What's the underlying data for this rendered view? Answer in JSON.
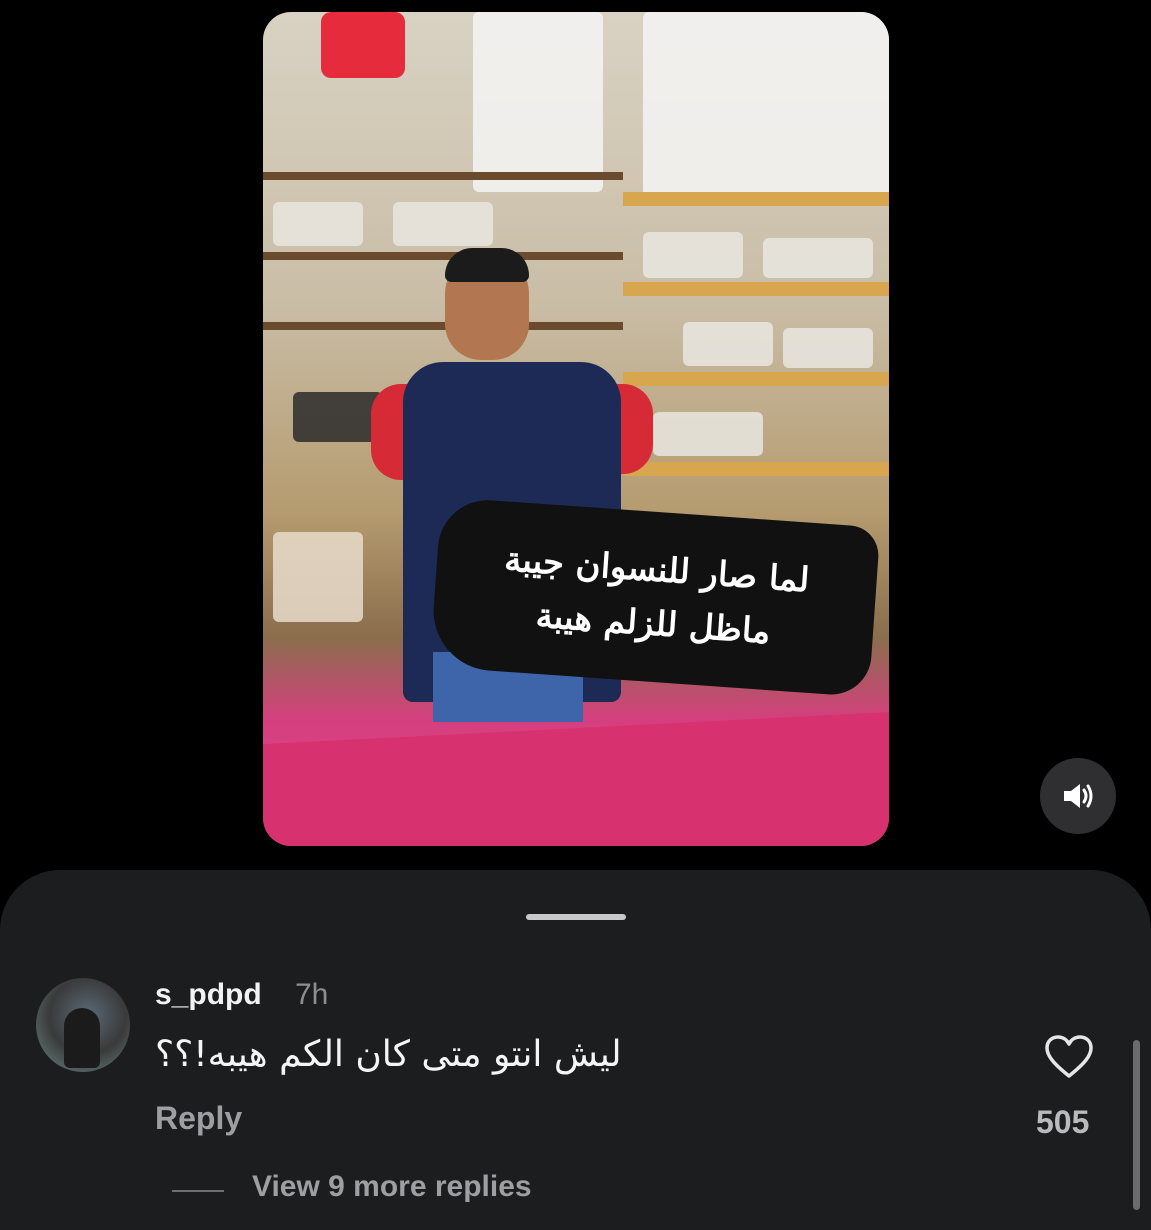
{
  "video": {
    "overlay_lines": [
      "لما صار للنسوان جيبة",
      "ماظل للزلم هيبة"
    ],
    "sound_icon": "speaker-volume-icon"
  },
  "comments_sheet": {
    "comment": {
      "username": "s_pdpd",
      "time": "7h",
      "text": "ليش انتو متى كان الكم هيبه!؟؟",
      "reply_label": "Reply",
      "like_icon": "heart-outline-icon",
      "likes": "505"
    },
    "view_more_label": "View 9 more replies"
  }
}
